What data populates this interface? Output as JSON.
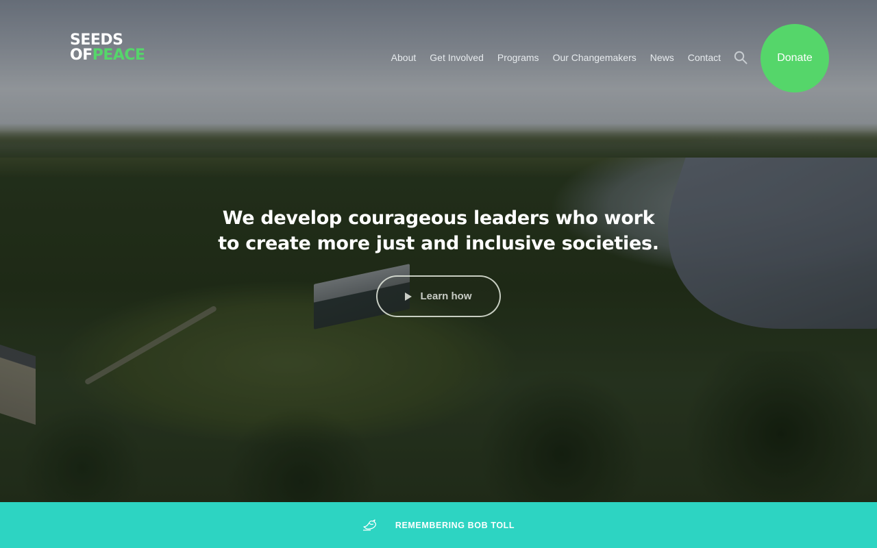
{
  "logo": {
    "line1": "SEEDS",
    "line2_a": "OF",
    "line2_b": "PEACE"
  },
  "nav": {
    "items": [
      "About",
      "Get Involved",
      "Programs",
      "Our Changemakers",
      "News",
      "Contact"
    ],
    "search_icon": "search-icon"
  },
  "donate": {
    "label": "Donate",
    "color": "#55d66a"
  },
  "hero": {
    "headline_line1": "We develop courageous leaders who work",
    "headline_line2": "to create more just and inclusive societies.",
    "cta_label": "Learn how",
    "cta_icon": "play-icon"
  },
  "banner": {
    "text": "REMEMBERING BOB TOLL",
    "icon": "dove-icon",
    "color": "#2dd4c2"
  }
}
